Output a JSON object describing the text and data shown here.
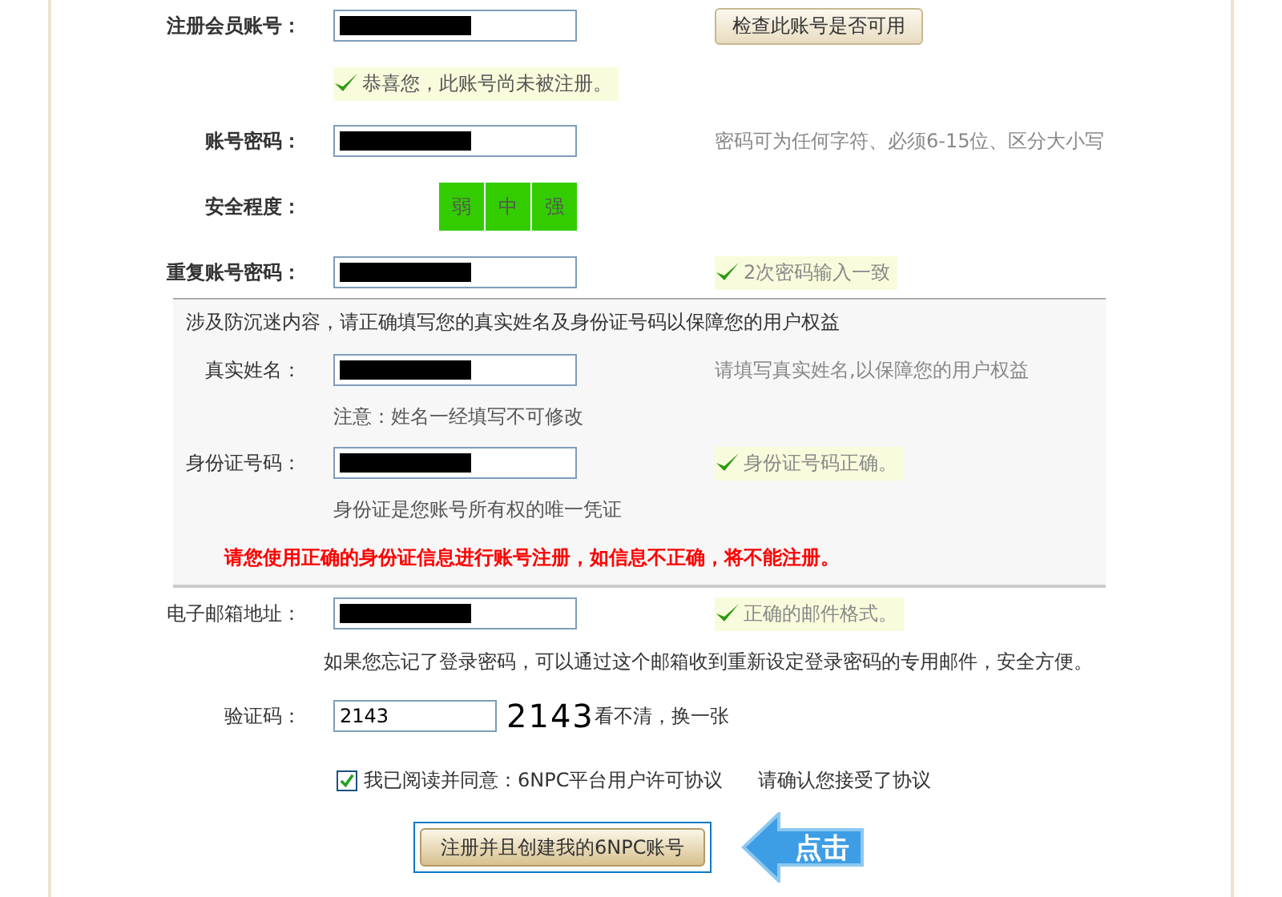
{
  "groups": [
    {
      "shaded": false,
      "rows": [
        {
          "kind": "field",
          "label": "注册会员账号：",
          "bold": true,
          "redacted": true,
          "button": "检查此账号是否可用"
        },
        {
          "kind": "note",
          "text": "恭喜您，此账号尚未被注册。",
          "ok": true
        },
        {
          "kind": "field",
          "label": "账号密码：",
          "bold": true,
          "redacted": true,
          "hint": "密码可为任何字符、必须6-15位、区分大小写"
        },
        {
          "kind": "strength",
          "label": "安全程度：",
          "bold": true,
          "segments": [
            {
              "label": "弱",
              "on": true
            },
            {
              "label": "中",
              "on": true
            },
            {
              "label": "强",
              "on": true
            }
          ]
        },
        {
          "kind": "field",
          "label": "重复账号密码：",
          "bold": true,
          "redacted": true,
          "ok_message": "2次密码输入一致"
        }
      ]
    },
    {
      "shaded": true,
      "rows": [
        {
          "kind": "notice",
          "text": "涉及防沉迷内容，请正确填写您的真实姓名及身份证号码以保障您的用户权益"
        },
        {
          "kind": "field",
          "label": "真实姓名：",
          "bold": false,
          "redacted": true,
          "hint": "请填写真实姓名,以保障您的用户权益"
        },
        {
          "kind": "note",
          "text": "注意：姓名一经填写不可修改",
          "ok": false
        },
        {
          "kind": "field",
          "label": "身份证号码：",
          "bold": false,
          "redacted": true,
          "ok_message": "身份证号码正确。"
        },
        {
          "kind": "note",
          "text": "身份证是您账号所有权的唯一凭证",
          "ok": false
        },
        {
          "kind": "warning",
          "text": "请您使用正确的身份证信息进行账号注册，如信息不正确，将不能注册。"
        }
      ]
    },
    {
      "shaded": false,
      "rows": [
        {
          "kind": "field",
          "label": "电子邮箱地址：",
          "bold": false,
          "redacted": true,
          "ok_message": "正确的邮件格式。"
        },
        {
          "kind": "help",
          "text": "如果您忘记了登录密码，可以通过这个邮箱收到重新设定登录密码的专用邮件，安全方便。"
        },
        {
          "kind": "captcha",
          "label": "验证码：",
          "value": "2143",
          "image_text": "2143",
          "link": "看不清，换一张"
        },
        {
          "kind": "agreement",
          "checked": true,
          "text": "我已阅读并同意：6NPC平台用户许可协议",
          "hint": "请确认您接受了协议"
        },
        {
          "kind": "submit",
          "label": "注册并且创建我的6NPC账号",
          "arrow_text": "点击"
        }
      ]
    }
  ]
}
